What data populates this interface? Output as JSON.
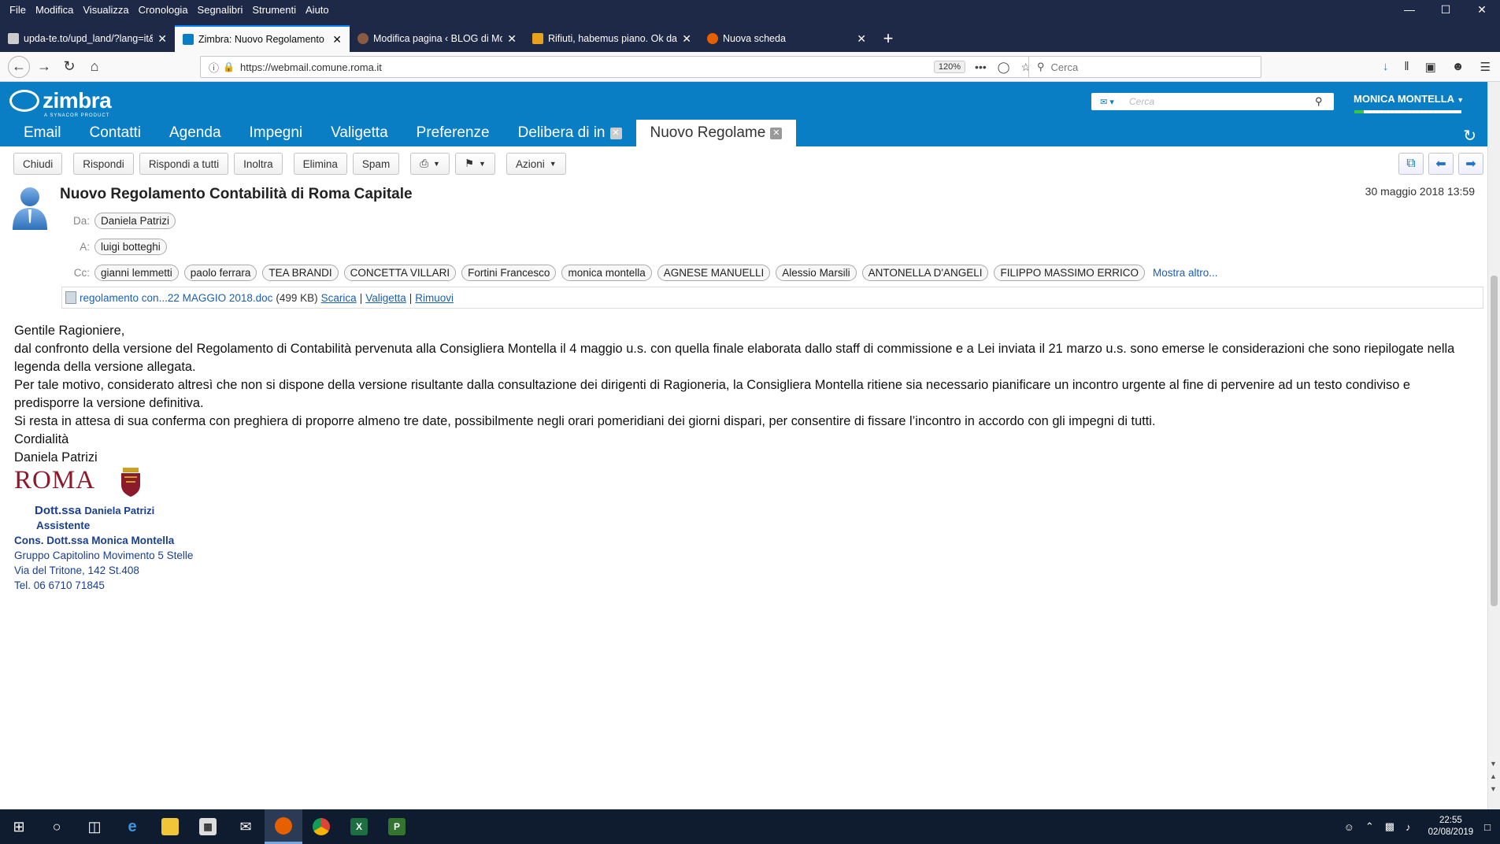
{
  "browser": {
    "menu": [
      "File",
      "Modifica",
      "Visualizza",
      "Cronologia",
      "Segnalibri",
      "Strumenti",
      "Aiuto"
    ],
    "tabs": [
      {
        "title": "upda-te.to/upd_land/?lang=it&sh",
        "icon_color": "#cccccc"
      },
      {
        "title": "Zimbra: Nuovo Regolamento C",
        "icon_color": "#0a7ec5"
      },
      {
        "title": "Modifica pagina ‹ BLOG di Mo",
        "icon_color": "#8a5a44"
      },
      {
        "title": "Rifiuti, habemus piano. Ok dall",
        "icon_color": "#e8a11d"
      },
      {
        "title": "Nuova scheda",
        "icon_color": "#e66000"
      }
    ],
    "url": "https://webmail.comune.roma.it",
    "zoom": "120%",
    "search_placeholder": "Cerca"
  },
  "zimbra": {
    "logo": "zimbra",
    "logo_sub": "A SYNACOR PRODUCT",
    "search_placeholder": "Cerca",
    "user": "MONICA MONTELLA",
    "quota_fraction": 0.09,
    "app_tabs": [
      {
        "label": "Email",
        "active": false,
        "closable": false
      },
      {
        "label": "Contatti",
        "active": false,
        "closable": false
      },
      {
        "label": "Agenda",
        "active": false,
        "closable": false
      },
      {
        "label": "Impegni",
        "active": false,
        "closable": false
      },
      {
        "label": "Valigetta",
        "active": false,
        "closable": false
      },
      {
        "label": "Preferenze",
        "active": false,
        "closable": false
      },
      {
        "label": "Delibera di in",
        "active": false,
        "closable": true
      },
      {
        "label": "Nuovo Regolame",
        "active": true,
        "closable": true
      }
    ],
    "actions": {
      "close": "Chiudi",
      "reply": "Rispondi",
      "reply_all": "Rispondi a tutti",
      "forward": "Inoltra",
      "delete": "Elimina",
      "spam": "Spam",
      "more": "Azioni"
    }
  },
  "message": {
    "subject": "Nuovo Regolamento Contabilità di Roma Capitale",
    "date": "30 maggio 2018 13:59",
    "from_label": "Da:",
    "from": "Daniela Patrizi",
    "to_label": "A:",
    "to": "luigi botteghi",
    "cc_label": "Cc:",
    "cc": [
      "gianni lemmetti",
      "paolo ferrara",
      "TEA BRANDI",
      "CONCETTA VILLARI",
      "Fortini Francesco",
      "monica montella",
      "AGNESE MANUELLI",
      "Alessio Marsili",
      "ANTONELLA D'ANGELI",
      "FILIPPO MASSIMO ERRICO"
    ],
    "show_more": "Mostra altro...",
    "attachment": {
      "name": "regolamento con...22 MAGGIO 2018.doc",
      "size": "(499 KB)",
      "download": "Scarica",
      "briefcase": "Valigetta",
      "remove": "Rimuovi"
    },
    "body": [
      "Gentile Ragioniere,",
      "dal confronto della versione del Regolamento di Contabilità pervenuta alla Consigliera Montella il 4 maggio u.s.  con quella finale elaborata dallo staff di commissione e a Lei inviata il 21 marzo u.s. sono emerse le considerazioni che sono riepilogate nella legenda della versione allegata.",
      "Per tale motivo, considerato altresì  che non si dispone della versione risultante dalla consultazione dei dirigenti di Ragioneria,  la Consigliera Montella ritiene sia necessario pianificare  un incontro urgente al fine di pervenire ad un testo condiviso e predisporre la versione definitiva.",
      "Si  resta in attesa di sua conferma con preghiera di proporre almeno tre date, possibilmente negli orari pomeridiani dei giorni dispari, per consentire di fissare l’incontro in accordo con gli impegni  di tutti.",
      "Cordialità",
      "Daniela Patrizi"
    ],
    "signature": {
      "logo": "ROMA",
      "title_prefix": "Dott.ssa",
      "name": "Daniela Patrizi",
      "role": "Assistente",
      "for": "Cons. Dott.ssa Monica Montella",
      "group": "Gruppo Capitolino Movimento 5 Stelle",
      "address": "Via del Tritone, 142 St.408",
      "phone": "Tel. 06 6710 71845"
    }
  },
  "taskbar": {
    "time": "22:55",
    "date": "02/08/2019"
  }
}
